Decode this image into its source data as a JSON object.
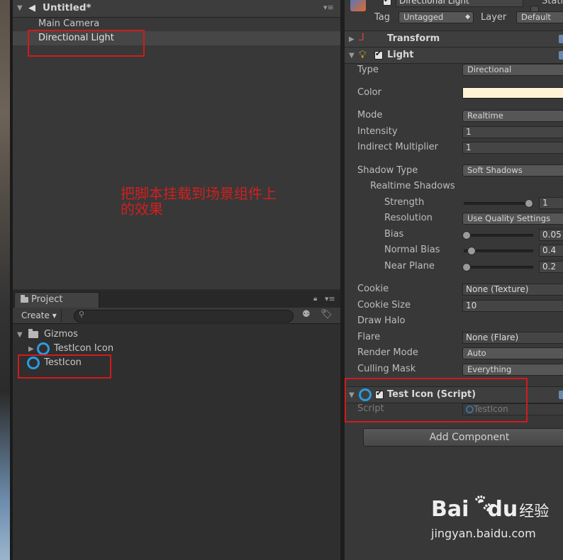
{
  "hierarchy": {
    "scene_title": "Untitled*",
    "items": [
      "Main Camera",
      "Directional Light"
    ]
  },
  "annotation": {
    "line1": "把脚本挂载到场景组件上",
    "line2": "的效果"
  },
  "project": {
    "tab_label": "Project",
    "create_label": "Create",
    "items": {
      "folder": "Gizmos",
      "child": "TestIcon Icon",
      "root_item": "TestIcon"
    }
  },
  "inspector": {
    "object_name": "Directional Light",
    "static_label": "Stati",
    "tag_label": "Tag",
    "tag_value": "Untagged",
    "layer_label": "Layer",
    "layer_value": "Default",
    "transform_title": "Transform",
    "light_title": "Light",
    "light_color_hex": "#fff4d6",
    "rows": {
      "type": {
        "label": "Type",
        "value": "Directional"
      },
      "color": {
        "label": "Color"
      },
      "mode": {
        "label": "Mode",
        "value": "Realtime"
      },
      "intensity": {
        "label": "Intensity",
        "value": "1"
      },
      "indirect": {
        "label": "Indirect Multiplier",
        "value": "1"
      },
      "shadow_type": {
        "label": "Shadow Type",
        "value": "Soft Shadows"
      },
      "realtime_shadows": {
        "label": "Realtime Shadows"
      },
      "strength": {
        "label": "Strength",
        "value": "1",
        "slider": 1.0
      },
      "resolution": {
        "label": "Resolution",
        "value": "Use Quality Settings"
      },
      "bias": {
        "label": "Bias",
        "value": "0.05",
        "slider": 0.0
      },
      "normal_bias": {
        "label": "Normal Bias",
        "value": "0.4",
        "slider": 0.08
      },
      "near_plane": {
        "label": "Near Plane",
        "value": "0.2",
        "slider": 0.0
      },
      "cookie": {
        "label": "Cookie",
        "value": "None (Texture)"
      },
      "cookie_size": {
        "label": "Cookie Size",
        "value": "10"
      },
      "draw_halo": {
        "label": "Draw Halo"
      },
      "flare": {
        "label": "Flare",
        "value": "None (Flare)"
      },
      "render_mode": {
        "label": "Render Mode",
        "value": "Auto"
      },
      "culling_mask": {
        "label": "Culling Mask",
        "value": "Everything"
      }
    },
    "script_component": {
      "title": "Test Icon (Script)",
      "script_label": "Script",
      "script_value": "TestIcon"
    },
    "add_component_label": "Add Component"
  },
  "watermark": {
    "brand": "Bai",
    "brand2": "du",
    "suffix": "经验",
    "url": "jingyan.baidu.com"
  },
  "colors": {
    "accent_icon": "#2a9be0",
    "highlight_box": "#d11b1b",
    "annotation_text": "#d0201f"
  }
}
